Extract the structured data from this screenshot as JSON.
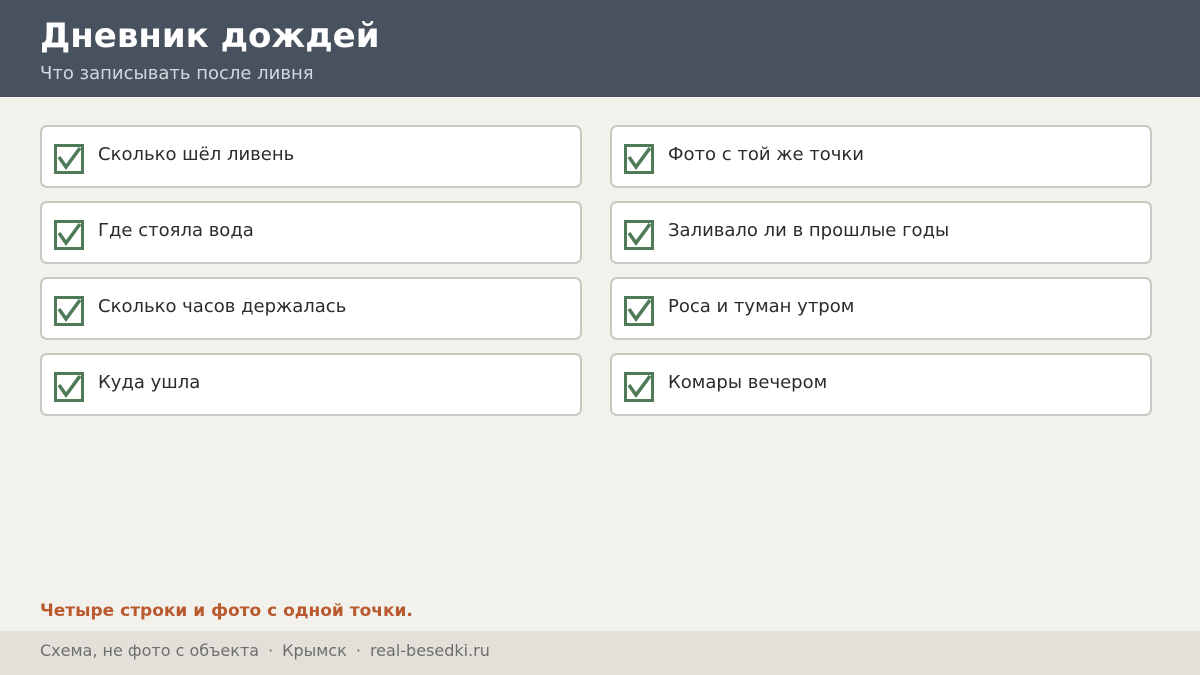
{
  "header": {
    "title": "Дневник дождей",
    "subtitle": "Что записывать после ливня"
  },
  "checklist": {
    "left": [
      {
        "label": "Сколько шёл ливень",
        "checked": true
      },
      {
        "label": "Где стояла вода",
        "checked": true
      },
      {
        "label": "Сколько часов держалась",
        "checked": true
      },
      {
        "label": "Куда ушла",
        "checked": true
      }
    ],
    "right": [
      {
        "label": "Фото с той же точки",
        "checked": true
      },
      {
        "label": "Заливало ли в прошлые годы",
        "checked": true
      },
      {
        "label": "Роса и туман утром",
        "checked": true
      },
      {
        "label": "Комары вечером",
        "checked": true
      }
    ]
  },
  "note": "Четыре строки и фото с одной точки.",
  "footer": {
    "caption": "Схема, не фото с объекта",
    "separator": "·",
    "city": "Крымск",
    "site": "real-besedki.ru"
  },
  "colors": {
    "header_bg": "#48515e",
    "check": "#4f7a57",
    "accent": "#b85a2e"
  },
  "icons": {
    "check": "checkbox-checked-icon"
  }
}
